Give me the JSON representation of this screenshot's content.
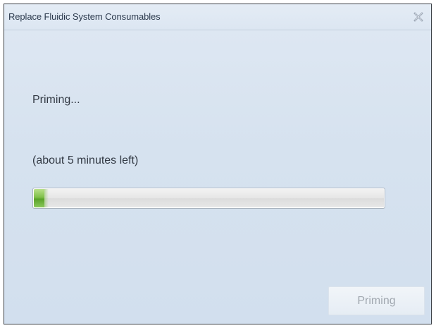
{
  "window": {
    "title": "Replace Fluidic System Consumables",
    "close_icon": "close-icon"
  },
  "main": {
    "status": "Priming...",
    "time_remaining": "(about 5 minutes left)",
    "progress_fraction": 0.03
  },
  "footer": {
    "action_label": "Priming",
    "action_enabled": false
  },
  "colors": {
    "progress_fill": "#6fb53a",
    "disabled_text": "#a1a8b0",
    "title_text": "#2c3a4d"
  }
}
